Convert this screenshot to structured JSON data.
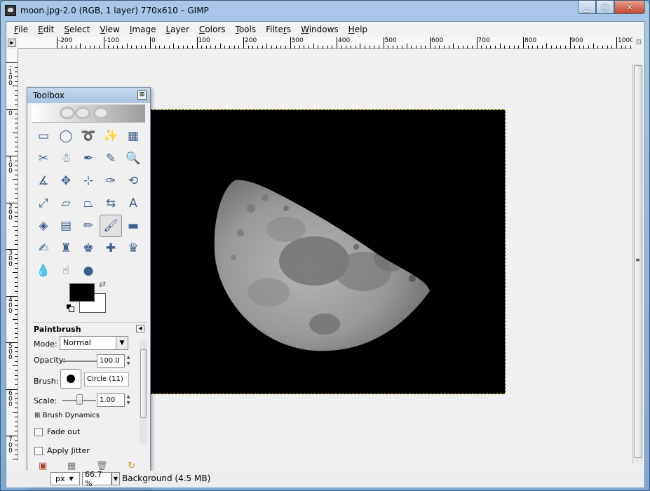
{
  "window": {
    "title": "moon.jpg-2.0 (RGB, 1 layer) 770x610 – GIMP",
    "controls": {
      "minimize": "▁",
      "maximize": "▢",
      "close": "✕"
    }
  },
  "menu": [
    {
      "label": "File",
      "key": "F",
      "rest": "ile"
    },
    {
      "label": "Edit",
      "key": "E",
      "rest": "dit"
    },
    {
      "label": "Select",
      "key": "S",
      "rest": "elect"
    },
    {
      "label": "View",
      "key": "V",
      "rest": "iew"
    },
    {
      "label": "Image",
      "key": "I",
      "rest": "mage"
    },
    {
      "label": "Layer",
      "key": "L",
      "rest": "ayer"
    },
    {
      "label": "Colors",
      "key": "C",
      "rest": "olors"
    },
    {
      "label": "Tools",
      "key": "T",
      "rest": "ools"
    },
    {
      "label": "Filters",
      "key": "r",
      "pre": "Filte",
      "rest": "s"
    },
    {
      "label": "Windows",
      "key": "W",
      "rest": "indows"
    },
    {
      "label": "Help",
      "key": "H",
      "rest": "elp"
    }
  ],
  "ruler": {
    "h_labels": [
      "-200",
      "-100",
      "0",
      "100",
      "200",
      "300",
      "400",
      "500",
      "600",
      "700",
      "800",
      "900",
      "1000"
    ],
    "v_labels": [
      "-100",
      "0",
      "100",
      "200",
      "300",
      "400",
      "500",
      "600",
      "700"
    ]
  },
  "toolbox": {
    "title": "Toolbox",
    "close": "⊠",
    "tools": [
      {
        "name": "rect-select-icon",
        "glyph": "▭"
      },
      {
        "name": "ellipse-select-icon",
        "glyph": "◯"
      },
      {
        "name": "free-select-icon",
        "glyph": "➰"
      },
      {
        "name": "fuzzy-select-icon",
        "glyph": "✨"
      },
      {
        "name": "select-by-color-icon",
        "glyph": "▦"
      },
      {
        "name": "scissors-select-icon",
        "glyph": "✂"
      },
      {
        "name": "foreground-select-icon",
        "glyph": "☃"
      },
      {
        "name": "paths-icon",
        "glyph": "✒"
      },
      {
        "name": "color-picker-icon",
        "glyph": "✎"
      },
      {
        "name": "zoom-icon",
        "glyph": "🔍"
      },
      {
        "name": "measure-icon",
        "glyph": "∡"
      },
      {
        "name": "move-icon",
        "glyph": "✥"
      },
      {
        "name": "align-icon",
        "glyph": "⊹"
      },
      {
        "name": "crop-icon",
        "glyph": "✑"
      },
      {
        "name": "rotate-icon",
        "glyph": "⟲"
      },
      {
        "name": "scale-icon",
        "glyph": "⤢"
      },
      {
        "name": "shear-icon",
        "glyph": "▱"
      },
      {
        "name": "perspective-icon",
        "glyph": "⏢"
      },
      {
        "name": "flip-icon",
        "glyph": "⇆"
      },
      {
        "name": "text-icon",
        "glyph": "A"
      },
      {
        "name": "bucket-fill-icon",
        "glyph": "◈"
      },
      {
        "name": "blend-icon",
        "glyph": "▤"
      },
      {
        "name": "pencil-icon",
        "glyph": "✏"
      },
      {
        "name": "paintbrush-icon",
        "glyph": "🖌"
      },
      {
        "name": "eraser-icon",
        "glyph": "▬"
      },
      {
        "name": "airbrush-icon",
        "glyph": "✍"
      },
      {
        "name": "ink-icon",
        "glyph": "♜"
      },
      {
        "name": "clone-icon",
        "glyph": "♚"
      },
      {
        "name": "heal-icon",
        "glyph": "✚"
      },
      {
        "name": "perspective-clone-icon",
        "glyph": "♛"
      },
      {
        "name": "blur-sharpen-icon",
        "glyph": "💧"
      },
      {
        "name": "smudge-icon",
        "glyph": "☝"
      },
      {
        "name": "dodge-burn-icon",
        "glyph": "●"
      }
    ],
    "active_tool": 23
  },
  "tool_options": {
    "title": "Paintbrush",
    "mode_label": "Mode:",
    "mode_value": "Normal",
    "opacity_label": "Opacity:",
    "opacity_value": "100.0",
    "opacity_fraction": 1.0,
    "brush_label": "Brush:",
    "brush_value": "Circle (11)",
    "scale_label": "Scale:",
    "scale_value": "1.00",
    "brush_dynamics": "Brush Dynamics",
    "fade_out": "Fade out",
    "apply_jitter": "Apply Jitter",
    "expander_glyph": "⊞"
  },
  "status": {
    "unit": "px",
    "zoom": "66.7 %",
    "layer_info": "Background (4.5 MB)"
  },
  "colors": {
    "foreground": "#000000",
    "background": "#ffffff",
    "selection_border": "#d8c200"
  }
}
